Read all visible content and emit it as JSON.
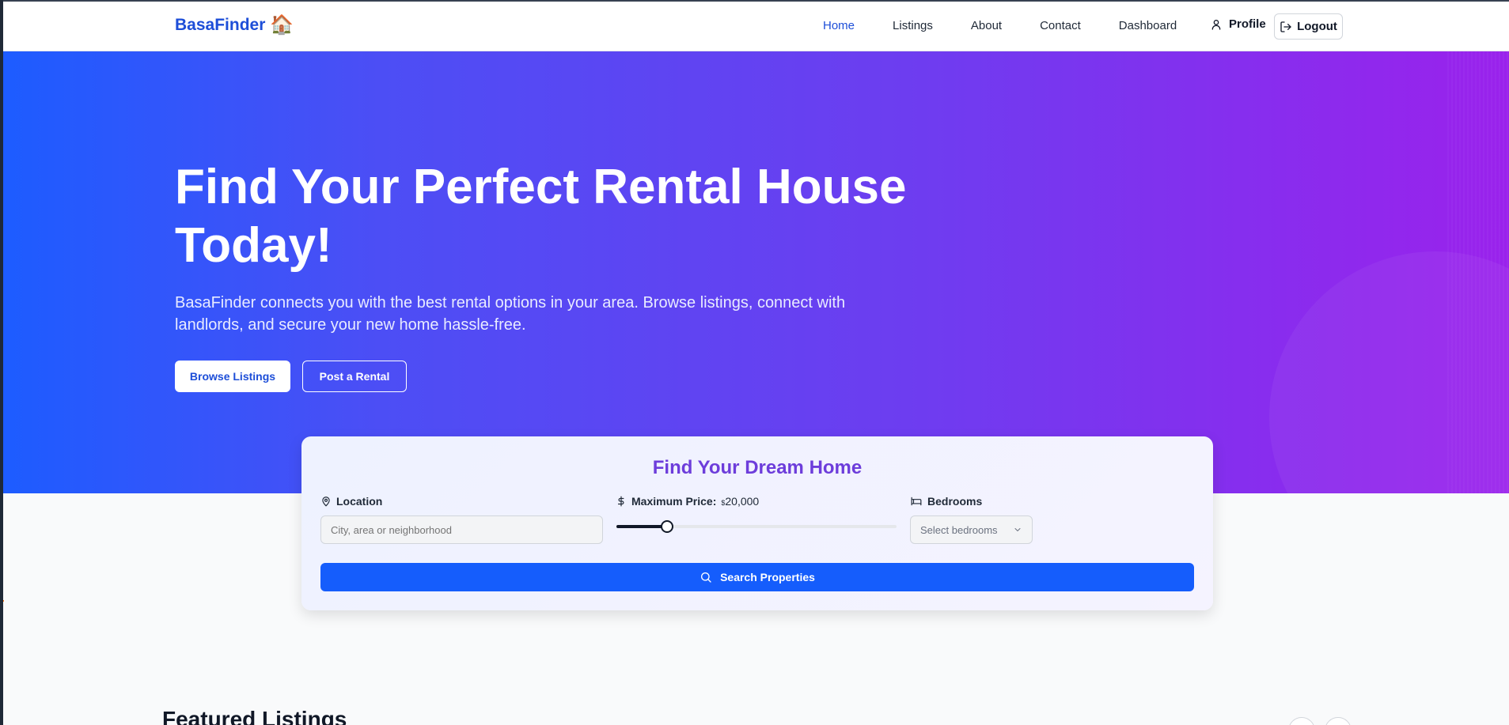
{
  "brand": {
    "name": "BasaFinder",
    "house_emoji": "🏠"
  },
  "nav": {
    "links": [
      "Home",
      "Listings",
      "About",
      "Contact",
      "Dashboard"
    ],
    "active": "Home",
    "profile": "Profile",
    "logout": "Logout"
  },
  "hero": {
    "title": "Find Your Perfect Rental House Today!",
    "subtitle": "BasaFinder connects you with the best rental options in your area. Browse listings, connect with landlords, and secure your new home hassle-free.",
    "browse_button": "Browse Listings",
    "post_button": "Post a Rental"
  },
  "search": {
    "title": "Find Your Dream Home",
    "location_label": "Location",
    "location_placeholder": "City, area or neighborhood",
    "price_label": "Maximum Price:",
    "price_currency": "$",
    "price_value": "20,000",
    "price_fraction": 0.18,
    "bedrooms_label": "Bedrooms",
    "bedrooms_placeholder": "Select bedrooms",
    "search_button": "Search Properties"
  },
  "featured": {
    "title": "Featured Listings"
  },
  "colors": {
    "primary": "#155dfc",
    "brand": "#1d4ed8",
    "accent_purple": "#6d3ddb",
    "hero_start": "#1d5cff",
    "hero_end": "#9a22ec"
  }
}
